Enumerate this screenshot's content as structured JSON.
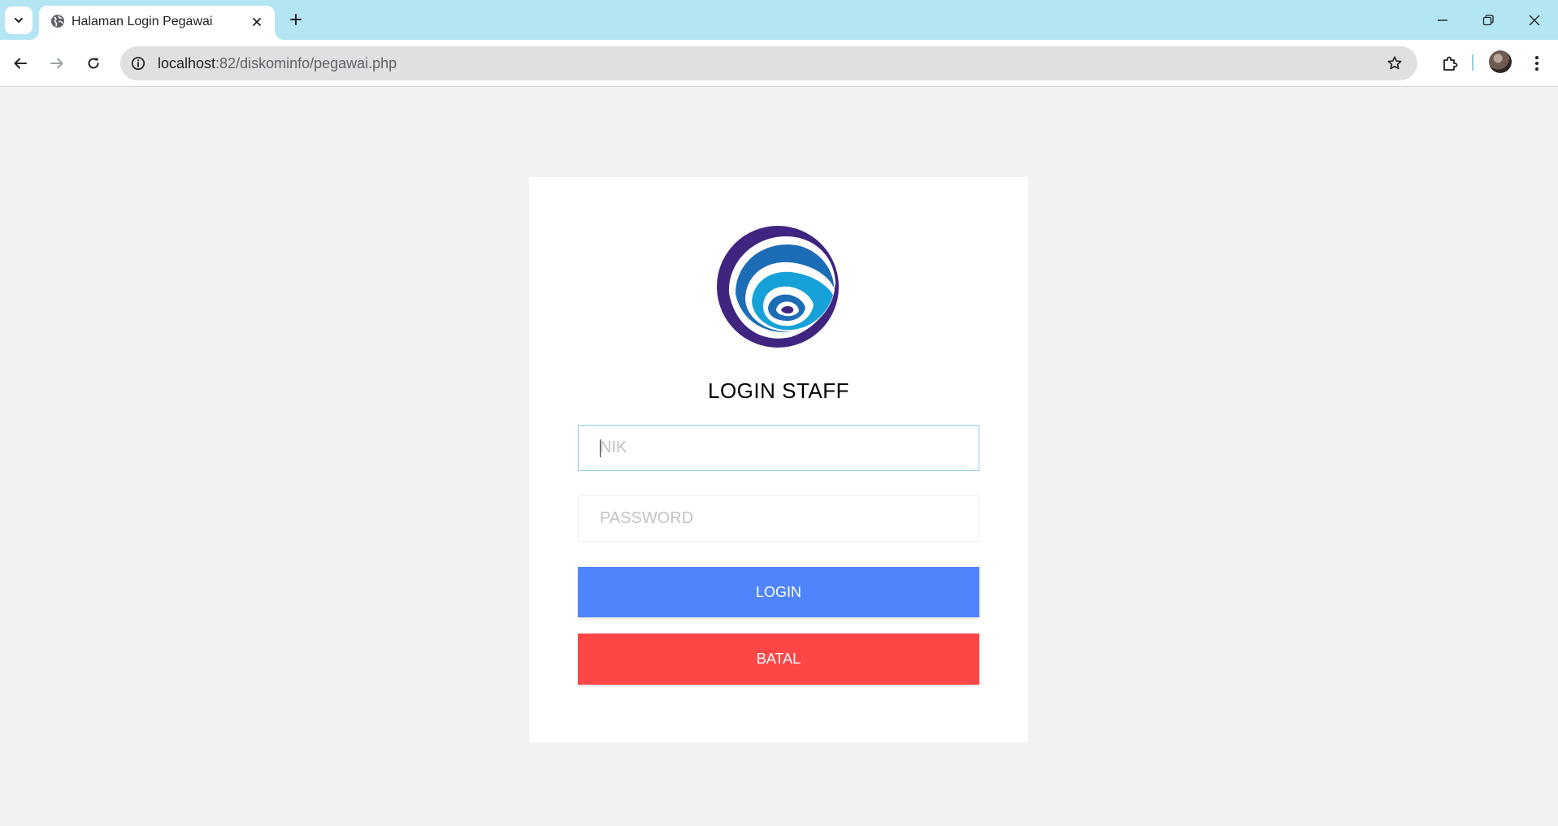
{
  "browser": {
    "tab_title": "Halaman Login Pegawai",
    "url_host": "localhost",
    "url_path": ":82/diskominfo/pegawai.php",
    "tabstrip_color": "#b4e5f2"
  },
  "icons": {
    "tab_search": "chevron-down-icon",
    "favicon": "globe-icon",
    "tab_close": "close-icon",
    "new_tab": "plus-icon",
    "minimize": "minimize-icon",
    "restore": "restore-icon",
    "close_window": "close-icon",
    "back": "arrow-left-icon",
    "forward": "arrow-right-icon",
    "reload": "reload-icon",
    "site_info": "info-icon",
    "bookmark": "star-icon",
    "extensions": "puzzle-icon",
    "menu": "kebab-menu-icon"
  },
  "login": {
    "title": "LOGIN STAFF",
    "nik_placeholder": "NIK",
    "password_placeholder": "PASSWORD",
    "login_button": "LOGIN",
    "cancel_button": "BATAL"
  },
  "colors": {
    "page_background": "#f2f2f2",
    "card_background": "#ffffff",
    "login_button": "#4f84fd",
    "cancel_button": "#ff4646",
    "focus_border": "#8ec9ea"
  }
}
